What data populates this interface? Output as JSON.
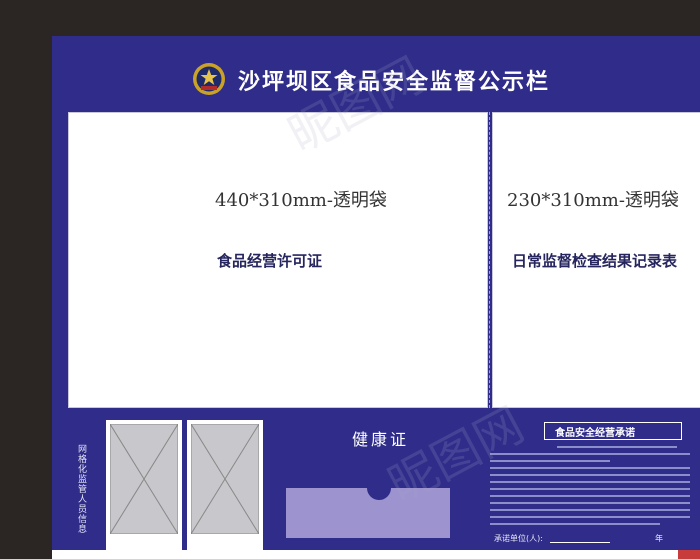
{
  "header": {
    "title": "沙坪坝区食品安全监督公示栏"
  },
  "panels": {
    "left": {
      "size": "440*310mm-透明袋",
      "label": "食品经营许可证"
    },
    "right": {
      "size": "230*310mm-透明袋",
      "label": "日常监督检查结果记录表"
    }
  },
  "lower": {
    "grid_info_label": "网格化监管人员信息",
    "health_title": "健康证",
    "pledge": {
      "title": "食品安全经营承诺",
      "sign_label": "承诺单位(人):",
      "year_label": "年"
    }
  },
  "watermark": {
    "text": "昵图网"
  },
  "colors": {
    "board_blue": "#2f2c8a",
    "slot_lavender": "#9c93cf",
    "accent_red": "#c73b3b"
  }
}
